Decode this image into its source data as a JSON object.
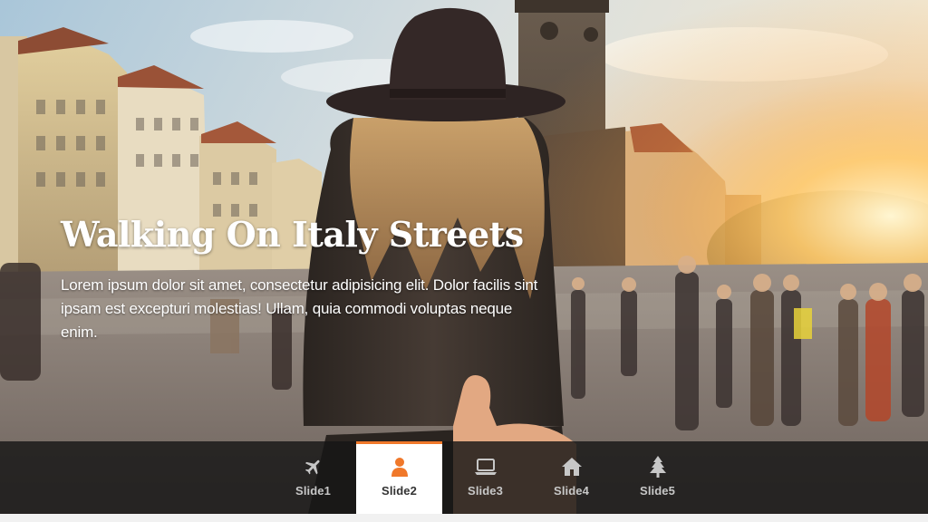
{
  "slide": {
    "title": "Walking On Italy Streets",
    "description": "Lorem ipsum dolor sit amet, consectetur adipisicing elit. Dolor facilis sint ipsam est excepturi molestias! Ullam, quia commodi voluptas neque enim."
  },
  "nav": {
    "active_index": 1,
    "accent_color": "#f0782a",
    "items": [
      {
        "label": "Slide1",
        "icon": "plane-icon"
      },
      {
        "label": "Slide2",
        "icon": "user-icon"
      },
      {
        "label": "Slide3",
        "icon": "laptop-icon"
      },
      {
        "label": "Slide4",
        "icon": "home-icon"
      },
      {
        "label": "Slide5",
        "icon": "tree-icon"
      }
    ]
  }
}
